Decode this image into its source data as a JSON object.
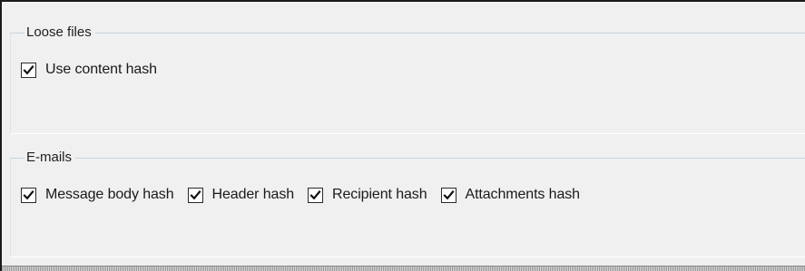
{
  "loose_files": {
    "title": "Loose files",
    "options": [
      {
        "label": "Use content hash",
        "checked": true
      }
    ]
  },
  "emails": {
    "title": "E-mails",
    "options": [
      {
        "label": "Message body hash",
        "checked": true
      },
      {
        "label": "Header hash",
        "checked": true
      },
      {
        "label": "Recipient hash",
        "checked": true
      },
      {
        "label": "Attachments hash",
        "checked": true
      }
    ]
  },
  "icons": {
    "checked": "checkmark-icon"
  }
}
